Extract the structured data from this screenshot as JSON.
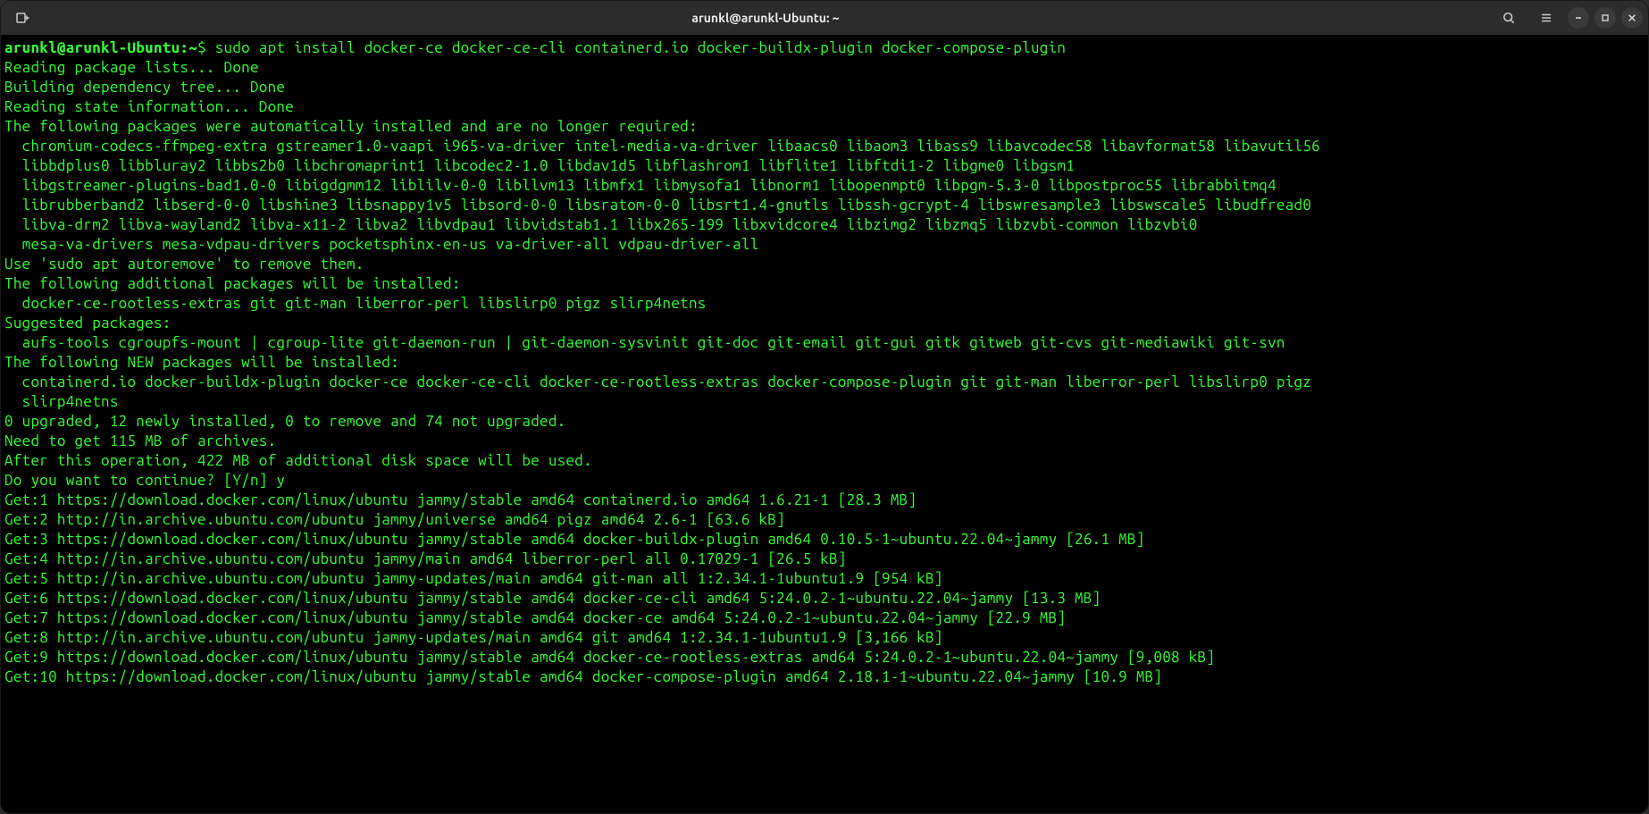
{
  "titlebar": {
    "title": "arunkl@arunkl-Ubuntu: ~"
  },
  "prompt": {
    "user_host": "arunkl@arunkl-Ubuntu",
    "path": "~",
    "symbol": "$"
  },
  "command": "sudo apt install docker-ce docker-ce-cli containerd.io docker-buildx-plugin docker-compose-plugin",
  "output": [
    "Reading package lists... Done",
    "Building dependency tree... Done",
    "Reading state information... Done",
    "The following packages were automatically installed and are no longer required:",
    "  chromium-codecs-ffmpeg-extra gstreamer1.0-vaapi i965-va-driver intel-media-va-driver libaacs0 libaom3 libass9 libavcodec58 libavformat58 libavutil56",
    "  libbdplus0 libbluray2 libbs2b0 libchromaprint1 libcodec2-1.0 libdav1d5 libflashrom1 libflite1 libftdi1-2 libgme0 libgsm1",
    "  libgstreamer-plugins-bad1.0-0 libigdgmm12 liblilv-0-0 libllvm13 libmfx1 libmysofa1 libnorm1 libopenmpt0 libpgm-5.3-0 libpostproc55 librabbitmq4",
    "  librubberband2 libserd-0-0 libshine3 libsnappy1v5 libsord-0-0 libsratom-0-0 libsrt1.4-gnutls libssh-gcrypt-4 libswresample3 libswscale5 libudfread0",
    "  libva-drm2 libva-wayland2 libva-x11-2 libva2 libvdpau1 libvidstab1.1 libx265-199 libxvidcore4 libzimg2 libzmq5 libzvbi-common libzvbi0",
    "  mesa-va-drivers mesa-vdpau-drivers pocketsphinx-en-us va-driver-all vdpau-driver-all",
    "Use 'sudo apt autoremove' to remove them.",
    "The following additional packages will be installed:",
    "  docker-ce-rootless-extras git git-man liberror-perl libslirp0 pigz slirp4netns",
    "Suggested packages:",
    "  aufs-tools cgroupfs-mount | cgroup-lite git-daemon-run | git-daemon-sysvinit git-doc git-email git-gui gitk gitweb git-cvs git-mediawiki git-svn",
    "The following NEW packages will be installed:",
    "  containerd.io docker-buildx-plugin docker-ce docker-ce-cli docker-ce-rootless-extras docker-compose-plugin git git-man liberror-perl libslirp0 pigz",
    "  slirp4netns",
    "0 upgraded, 12 newly installed, 0 to remove and 74 not upgraded.",
    "Need to get 115 MB of archives.",
    "After this operation, 422 MB of additional disk space will be used.",
    "Do you want to continue? [Y/n] y",
    "Get:1 https://download.docker.com/linux/ubuntu jammy/stable amd64 containerd.io amd64 1.6.21-1 [28.3 MB]",
    "Get:2 http://in.archive.ubuntu.com/ubuntu jammy/universe amd64 pigz amd64 2.6-1 [63.6 kB]",
    "Get:3 https://download.docker.com/linux/ubuntu jammy/stable amd64 docker-buildx-plugin amd64 0.10.5-1~ubuntu.22.04~jammy [26.1 MB]",
    "Get:4 http://in.archive.ubuntu.com/ubuntu jammy/main amd64 liberror-perl all 0.17029-1 [26.5 kB]",
    "Get:5 http://in.archive.ubuntu.com/ubuntu jammy-updates/main amd64 git-man all 1:2.34.1-1ubuntu1.9 [954 kB]",
    "Get:6 https://download.docker.com/linux/ubuntu jammy/stable amd64 docker-ce-cli amd64 5:24.0.2-1~ubuntu.22.04~jammy [13.3 MB]",
    "Get:7 https://download.docker.com/linux/ubuntu jammy/stable amd64 docker-ce amd64 5:24.0.2-1~ubuntu.22.04~jammy [22.9 MB]",
    "Get:8 http://in.archive.ubuntu.com/ubuntu jammy-updates/main amd64 git amd64 1:2.34.1-1ubuntu1.9 [3,166 kB]",
    "Get:9 https://download.docker.com/linux/ubuntu jammy/stable amd64 docker-ce-rootless-extras amd64 5:24.0.2-1~ubuntu.22.04~jammy [9,008 kB]",
    "Get:10 https://download.docker.com/linux/ubuntu jammy/stable amd64 docker-compose-plugin amd64 2.18.1-1~ubuntu.22.04~jammy [10.9 MB]"
  ]
}
